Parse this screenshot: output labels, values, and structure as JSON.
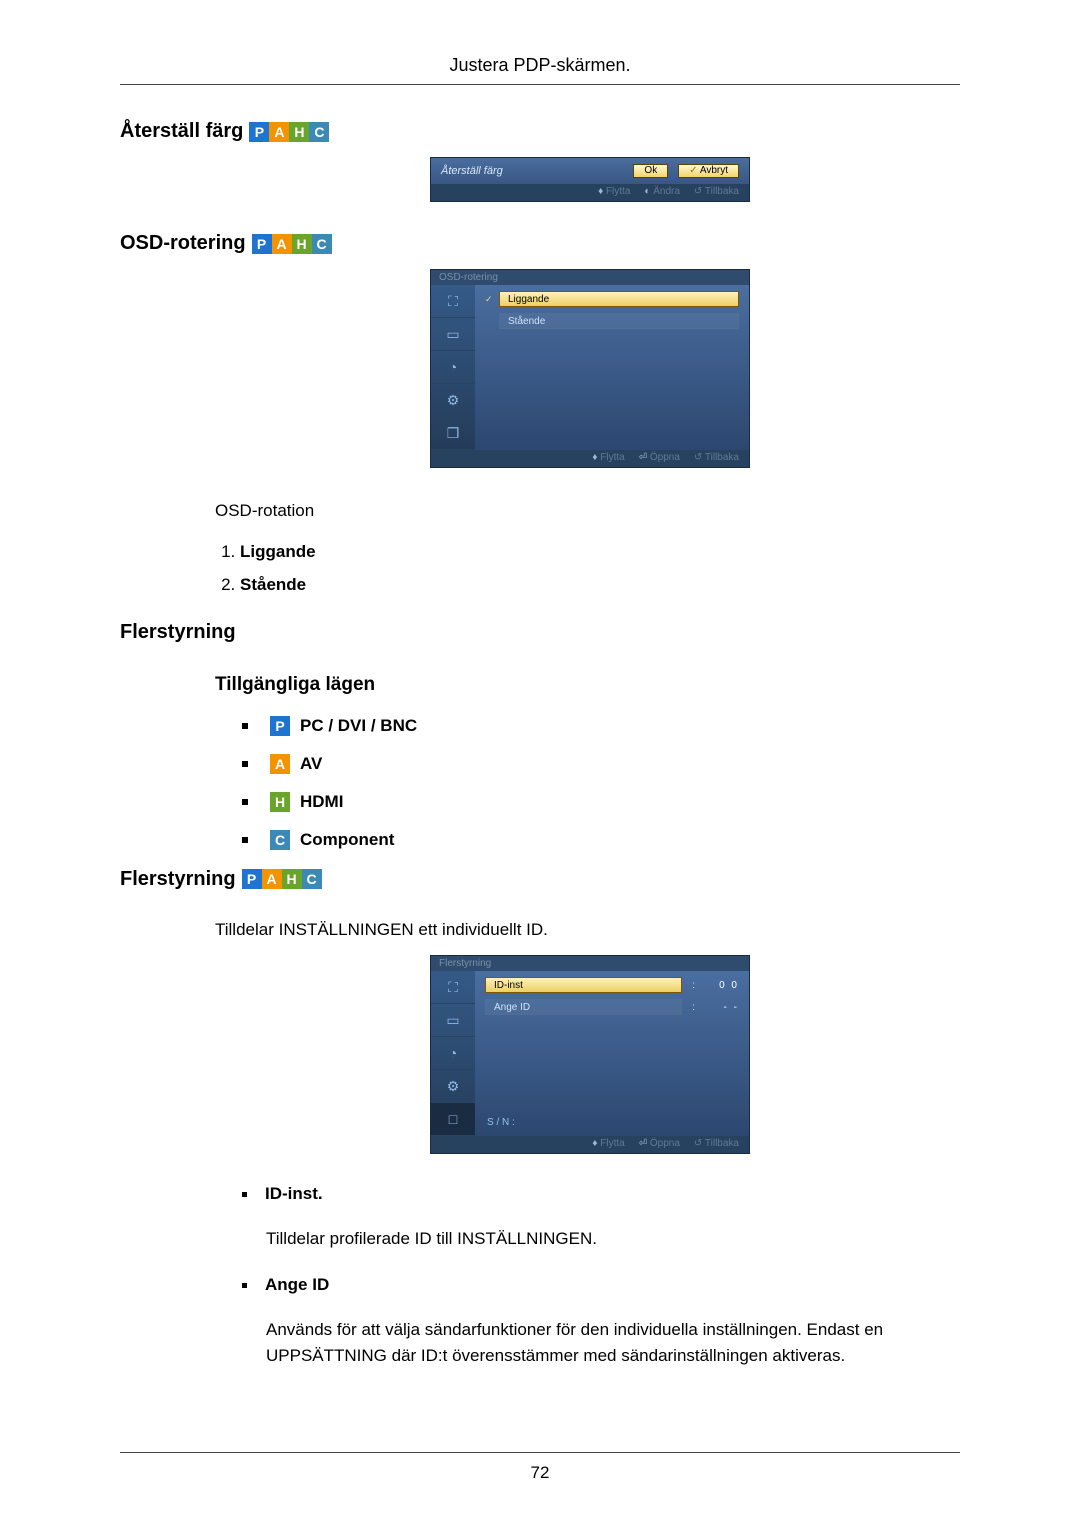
{
  "header": {
    "title": "Justera PDP-skärmen."
  },
  "badges": {
    "p": "P",
    "a": "A",
    "h": "H",
    "c": "C"
  },
  "sec1": {
    "title": "Återställ färg",
    "osd": {
      "label": "Återställ färg",
      "ok": "Ok",
      "cancel": "Avbryt",
      "f_move": "Flytta",
      "f_change": "Ändra",
      "f_back": "Tillbaka"
    }
  },
  "sec2": {
    "title": "OSD-rotering",
    "osd_header": "OSD-rotering",
    "opt1": "Liggande",
    "opt2": "Stående",
    "f_move": "Flytta",
    "f_open": "Öppna",
    "f_back": "Tillbaka",
    "body_label": "OSD-rotation",
    "li1": "Liggande",
    "li2": "Stående"
  },
  "sec3": {
    "title": "Flerstyrning",
    "sub": "Tillgängliga lägen",
    "m1": "PC / DVI / BNC",
    "m2": "AV",
    "m3": "HDMI",
    "m4": "Component"
  },
  "sec4": {
    "title": "Flerstyrning",
    "intro": "Tilldelar INSTÄLLNINGEN ett individuellt ID.",
    "osd_header": "Flerstyrning",
    "row1_label": "ID-inst",
    "row1_val": "0 0",
    "row2_label": "Ange ID",
    "row2_val": "- -",
    "sn": "S / N :",
    "f_move": "Flytta",
    "f_open": "Öppna",
    "f_back": "Tillbaka",
    "d1_term": "ID-inst.",
    "d1_expl": "Tilldelar profilerade ID till INSTÄLLNINGEN.",
    "d2_term": "Ange ID",
    "d2_expl": "Används för att välja sändarfunktioner för den individuella inställningen. Endast en UPPSÄTTNING där ID:t överensstämmer med sändarinställningen aktiveras."
  },
  "page_number": "72"
}
